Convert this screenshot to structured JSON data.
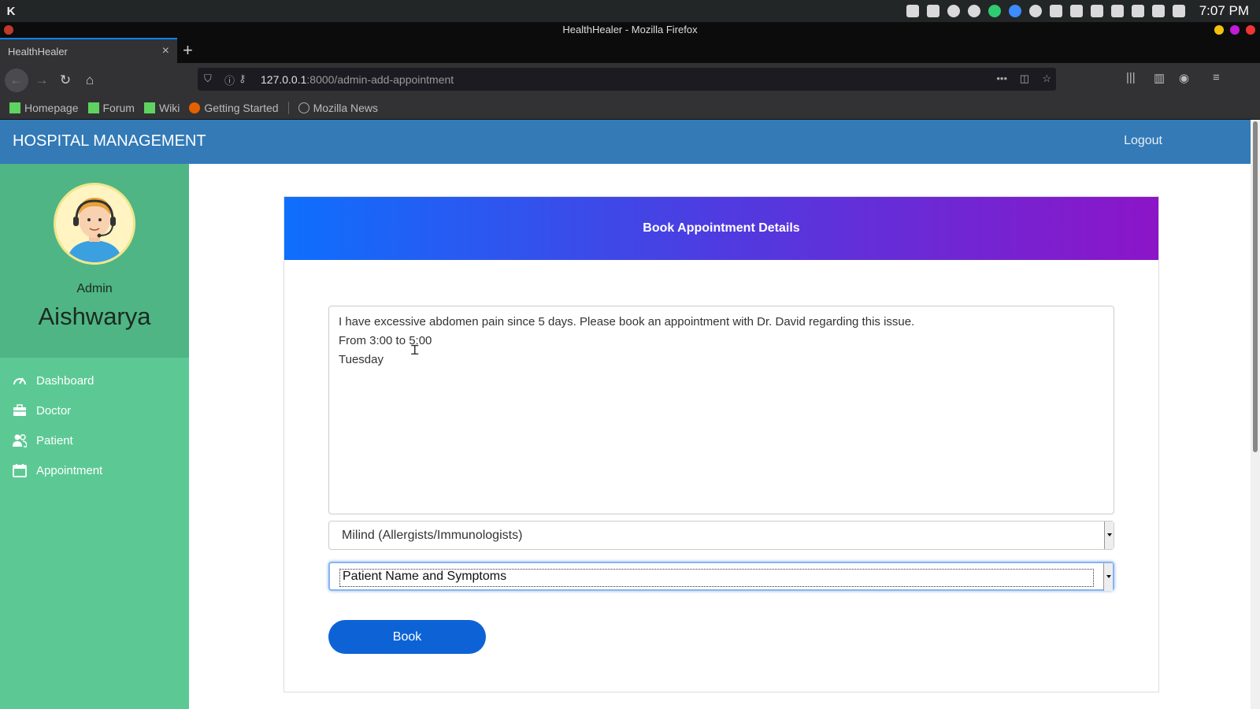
{
  "system": {
    "time": "7:07 PM"
  },
  "window": {
    "title": "HealthHealer - Mozilla Firefox"
  },
  "browser": {
    "tab_title": "HealthHealer",
    "url_host": "127.0.0.1",
    "url_rest": ":8000/admin-add-appointment",
    "bookmarks": [
      {
        "label": "Homepage",
        "icon": "manjaro-icon"
      },
      {
        "label": "Forum",
        "icon": "manjaro-icon"
      },
      {
        "label": "Wiki",
        "icon": "manjaro-icon"
      },
      {
        "label": "Getting Started",
        "icon": "firefox-icon"
      },
      {
        "label": "Mozilla News",
        "icon": "globe-icon"
      }
    ]
  },
  "header": {
    "brand": "HOSPITAL MANAGEMENT",
    "logout": "Logout"
  },
  "sidebar": {
    "role": "Admin",
    "name": "Aishwarya",
    "items": [
      {
        "label": "Dashboard",
        "icon": "speedometer-icon"
      },
      {
        "label": "Doctor",
        "icon": "briefcase-icon"
      },
      {
        "label": "Patient",
        "icon": "users-icon"
      },
      {
        "label": "Appointment",
        "icon": "calendar-icon"
      }
    ]
  },
  "form": {
    "title": "Book Appointment Details",
    "description": "I have excessive abdomen pain since 5 days. Please book an appointment with Dr. David regarding this issue.\nFrom 3:00 to 5:00\nTuesday",
    "doctor_select": "Milind (Allergists/Immunologists)",
    "patient_select": "Patient Name and Symptoms",
    "book_label": "Book"
  },
  "colors": {
    "topnav": "#337ab7",
    "sidebar": "#5cc995",
    "button": "#0d63d6"
  }
}
